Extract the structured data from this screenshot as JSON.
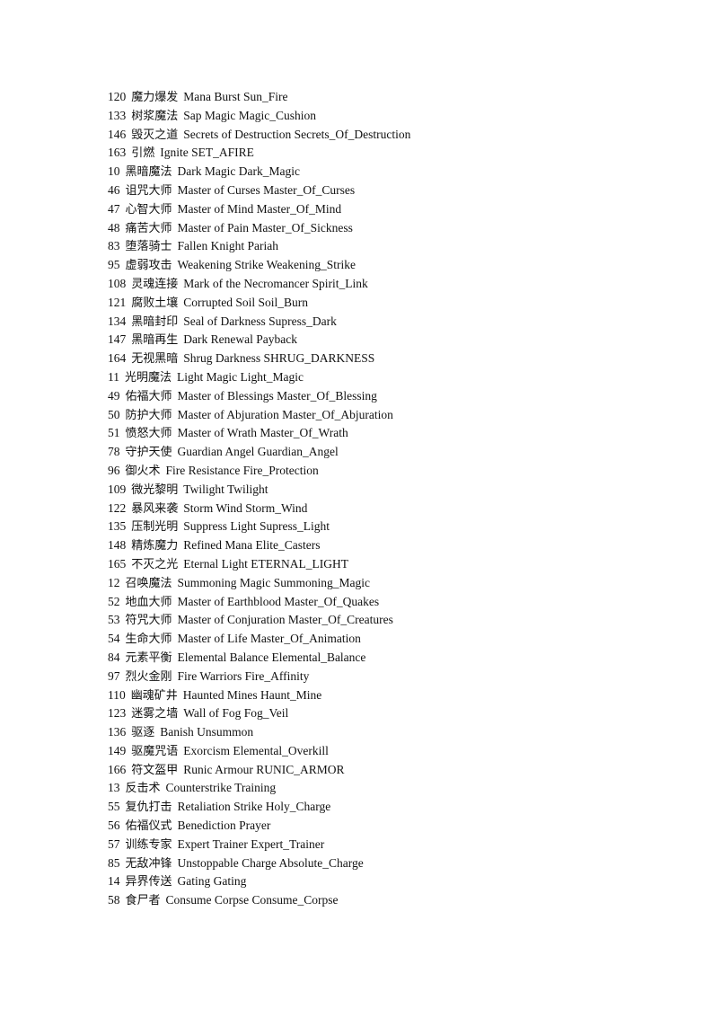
{
  "entries": [
    {
      "id": "120",
      "cn": "魔力爆发",
      "en": "Mana Burst Sun_Fire"
    },
    {
      "id": "133",
      "cn": "树浆魔法",
      "en": "Sap Magic Magic_Cushion"
    },
    {
      "id": "146",
      "cn": "毁灭之道",
      "en": "Secrets of Destruction Secrets_Of_Destruction"
    },
    {
      "id": "163",
      "cn": "引燃",
      "en": "Ignite SET_AFIRE"
    },
    {
      "id": "10",
      "cn": "黑暗魔法",
      "en": "Dark Magic Dark_Magic"
    },
    {
      "id": "46",
      "cn": "诅咒大师",
      "en": "Master of Curses Master_Of_Curses"
    },
    {
      "id": "47",
      "cn": "心智大师",
      "en": "Master of Mind Master_Of_Mind"
    },
    {
      "id": "48",
      "cn": "痛苦大师",
      "en": "Master of Pain Master_Of_Sickness"
    },
    {
      "id": "83",
      "cn": "堕落骑士",
      "en": "Fallen Knight Pariah"
    },
    {
      "id": "95",
      "cn": "虚弱攻击",
      "en": "Weakening Strike Weakening_Strike"
    },
    {
      "id": "108",
      "cn": "灵魂连接",
      "en": "Mark of the Necromancer Spirit_Link"
    },
    {
      "id": "121",
      "cn": "腐败土壤",
      "en": "Corrupted Soil Soil_Burn"
    },
    {
      "id": "134",
      "cn": "黑暗封印",
      "en": "Seal of Darkness Supress_Dark"
    },
    {
      "id": "147",
      "cn": "黑暗再生",
      "en": "Dark Renewal Payback"
    },
    {
      "id": "164",
      "cn": "无视黑暗",
      "en": "Shrug Darkness SHRUG_DARKNESS"
    },
    {
      "id": "11",
      "cn": "光明魔法",
      "en": "Light Magic Light_Magic"
    },
    {
      "id": "49",
      "cn": "佑福大师",
      "en": "Master of Blessings Master_Of_Blessing"
    },
    {
      "id": "50",
      "cn": "防护大师",
      "en": "Master of Abjuration Master_Of_Abjuration"
    },
    {
      "id": "51",
      "cn": "愤怒大师",
      "en": "Master of Wrath Master_Of_Wrath"
    },
    {
      "id": "78",
      "cn": "守护天使",
      "en": "Guardian Angel Guardian_Angel"
    },
    {
      "id": "96",
      "cn": "御火术",
      "en": "Fire Resistance Fire_Protection"
    },
    {
      "id": "109",
      "cn": "微光黎明",
      "en": "Twilight Twilight"
    },
    {
      "id": "122",
      "cn": "暴风来袭",
      "en": "Storm Wind Storm_Wind"
    },
    {
      "id": "135",
      "cn": "压制光明",
      "en": "Suppress Light Supress_Light"
    },
    {
      "id": "148",
      "cn": "精炼魔力",
      "en": "Refined Mana Elite_Casters"
    },
    {
      "id": "165",
      "cn": "不灭之光",
      "en": "Eternal Light ETERNAL_LIGHT"
    },
    {
      "id": "12",
      "cn": "召唤魔法",
      "en": "Summoning Magic Summoning_Magic"
    },
    {
      "id": "52",
      "cn": "地血大师",
      "en": "Master of Earthblood Master_Of_Quakes"
    },
    {
      "id": "53",
      "cn": "符咒大师",
      "en": "Master of Conjuration Master_Of_Creatures"
    },
    {
      "id": "54",
      "cn": "生命大师",
      "en": "Master of Life Master_Of_Animation"
    },
    {
      "id": "84",
      "cn": "元素平衡",
      "en": "Elemental Balance Elemental_Balance"
    },
    {
      "id": "97",
      "cn": "烈火金刚",
      "en": "Fire Warriors Fire_Affinity"
    },
    {
      "id": "110",
      "cn": "幽魂矿井",
      "en": "Haunted Mines Haunt_Mine"
    },
    {
      "id": "123",
      "cn": "迷雾之墙",
      "en": "Wall of Fog Fog_Veil"
    },
    {
      "id": "136",
      "cn": "驱逐",
      "en": "Banish Unsummon"
    },
    {
      "id": "149",
      "cn": "驱魔咒语",
      "en": "Exorcism Elemental_Overkill"
    },
    {
      "id": "166",
      "cn": "符文盔甲",
      "en": "Runic Armour RUNIC_ARMOR"
    },
    {
      "id": "13",
      "cn": "反击术",
      "en": "Counterstrike Training"
    },
    {
      "id": "55",
      "cn": "复仇打击",
      "en": "Retaliation Strike Holy_Charge"
    },
    {
      "id": "56",
      "cn": "佑福仪式",
      "en": "Benediction Prayer"
    },
    {
      "id": "57",
      "cn": "训练专家",
      "en": "Expert Trainer Expert_Trainer"
    },
    {
      "id": "85",
      "cn": "无敌冲锋",
      "en": "Unstoppable Charge Absolute_Charge"
    },
    {
      "id": "14",
      "cn": "异界传送",
      "en": "Gating Gating"
    },
    {
      "id": "58",
      "cn": "食尸者",
      "en": "Consume Corpse Consume_Corpse"
    }
  ]
}
